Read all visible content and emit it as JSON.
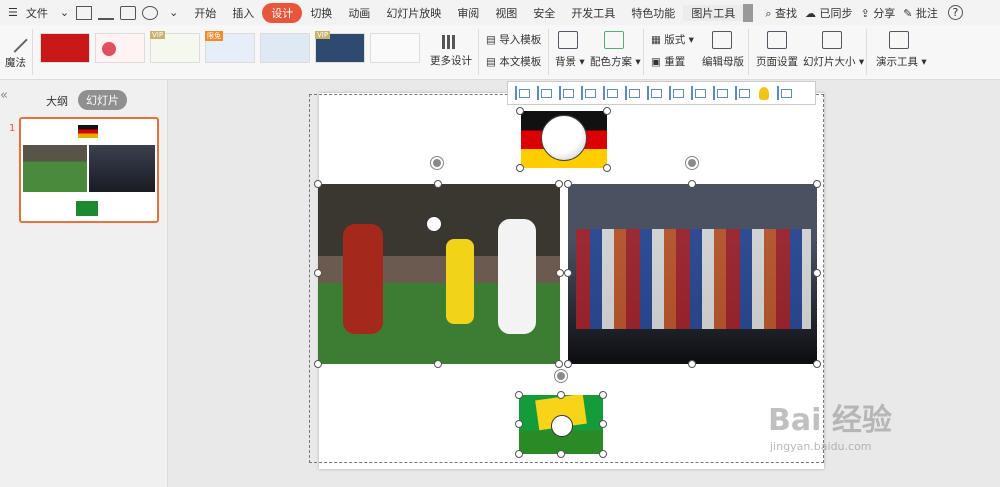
{
  "menubar": {
    "file": "文件",
    "tabs": [
      "开始",
      "插入",
      "设计",
      "切换",
      "动画",
      "幻灯片放映",
      "审阅",
      "视图",
      "安全",
      "开发工具",
      "特色功能",
      "图片工具"
    ],
    "active_tab": "设计",
    "search": "查找",
    "sync": "已同步",
    "share": "分享",
    "comment": "批注",
    "help": "?"
  },
  "ribbon": {
    "magic": "魔法",
    "more_designs": "更多设计",
    "import_template": "导入模板",
    "this_template": "本文模板",
    "background": "背景",
    "color_scheme": "配色方案",
    "layout": "版式",
    "reset": "重置",
    "edit_master": "编辑母版",
    "page_setup": "页面设置",
    "slide_size": "幻灯片大小",
    "present_tools": "演示工具",
    "vip": "VIP",
    "new_badge": "限免"
  },
  "panel": {
    "outline_tab": "大纲",
    "slides_tab": "幻灯片",
    "slide_number": "1",
    "collapse": "«"
  },
  "watermark": {
    "brand": "Bai 经验",
    "url": "jingyan.baidu.com"
  },
  "colors": {
    "accent": "#e8573b",
    "selection": "#e8573b"
  }
}
